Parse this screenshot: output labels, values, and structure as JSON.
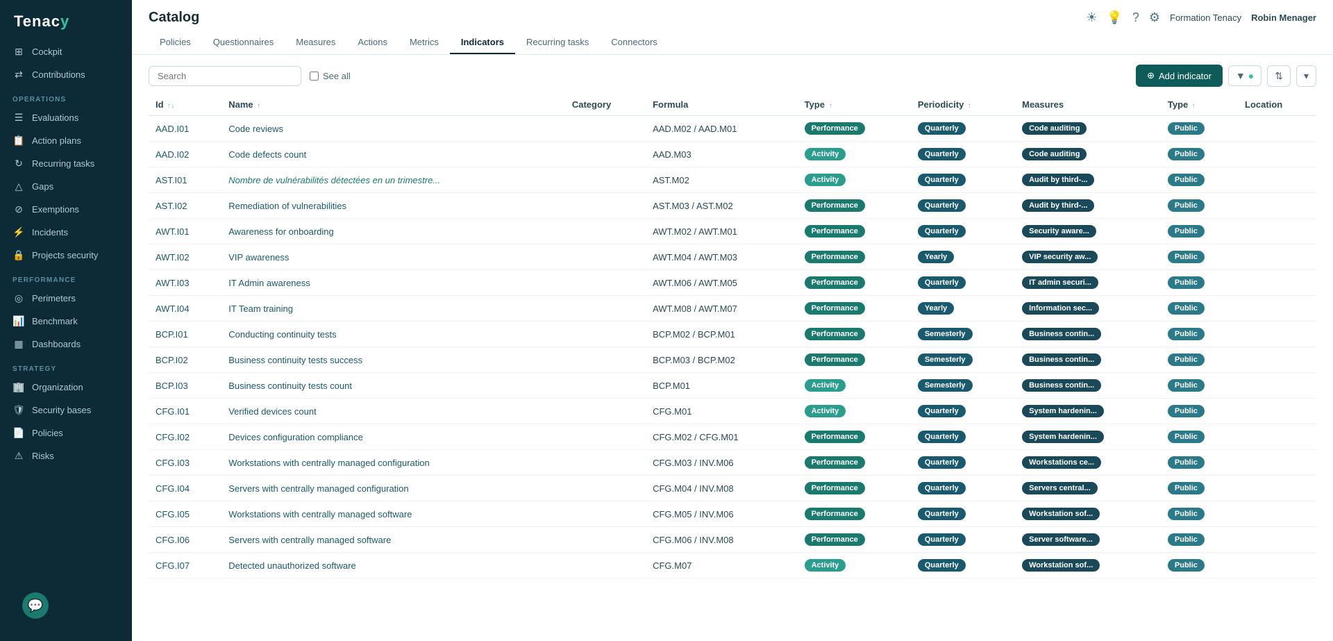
{
  "app": {
    "name": "Tenacy",
    "logo_accent": "y"
  },
  "topbar": {
    "title": "Catalog",
    "user_org": "Formation Tenacy",
    "user_name": "Robin Menager"
  },
  "tabs": [
    {
      "label": "Policies",
      "active": false
    },
    {
      "label": "Questionnaires",
      "active": false
    },
    {
      "label": "Measures",
      "active": false
    },
    {
      "label": "Actions",
      "active": false
    },
    {
      "label": "Metrics",
      "active": false
    },
    {
      "label": "Indicators",
      "active": true
    },
    {
      "label": "Recurring tasks",
      "active": false
    },
    {
      "label": "Connectors",
      "active": false
    }
  ],
  "toolbar": {
    "search_placeholder": "Search",
    "see_all_label": "See all",
    "add_button": "Add indicator"
  },
  "table": {
    "columns": [
      "Id",
      "Name",
      "Category",
      "Formula",
      "Type",
      "Periodicity",
      "Measures",
      "Type",
      "Location"
    ],
    "rows": [
      {
        "id": "AAD.I01",
        "name": "Code reviews",
        "category": "",
        "formula": "AAD.M02 / AAD.M01",
        "type": "Performance",
        "periodicity": "Quarterly",
        "measures": "Code auditing",
        "type2": "Public",
        "location": "",
        "name_italic": false
      },
      {
        "id": "AAD.I02",
        "name": "Code defects count",
        "category": "",
        "formula": "AAD.M03",
        "type": "Activity",
        "periodicity": "Quarterly",
        "measures": "Code auditing",
        "type2": "Public",
        "location": "",
        "name_italic": false
      },
      {
        "id": "AST.I01",
        "name": "Nombre de vulnérabilités détectées en un trimestre...",
        "category": "",
        "formula": "AST.M02",
        "type": "Activity",
        "periodicity": "Quarterly",
        "measures": "Audit by third-...",
        "type2": "Public",
        "location": "",
        "name_italic": true
      },
      {
        "id": "AST.I02",
        "name": "Remediation of vulnerabilities",
        "category": "",
        "formula": "AST.M03 / AST.M02",
        "type": "Performance",
        "periodicity": "Quarterly",
        "measures": "Audit by third-...",
        "type2": "Public",
        "location": "",
        "name_italic": false
      },
      {
        "id": "AWT.I01",
        "name": "Awareness for onboarding",
        "category": "",
        "formula": "AWT.M02 / AWT.M01",
        "type": "Performance",
        "periodicity": "Quarterly",
        "measures": "Security aware...",
        "type2": "Public",
        "location": "",
        "name_italic": false
      },
      {
        "id": "AWT.I02",
        "name": "VIP awareness",
        "category": "",
        "formula": "AWT.M04 / AWT.M03",
        "type": "Performance",
        "periodicity": "Yearly",
        "measures": "VIP security aw...",
        "type2": "Public",
        "location": "",
        "name_italic": false
      },
      {
        "id": "AWT.I03",
        "name": "IT Admin awareness",
        "category": "",
        "formula": "AWT.M06 / AWT.M05",
        "type": "Performance",
        "periodicity": "Quarterly",
        "measures": "IT admin securi...",
        "type2": "Public",
        "location": "",
        "name_italic": false
      },
      {
        "id": "AWT.I04",
        "name": "IT Team training",
        "category": "",
        "formula": "AWT.M08 / AWT.M07",
        "type": "Performance",
        "periodicity": "Yearly",
        "measures": "Information sec...",
        "type2": "Public",
        "location": "",
        "name_italic": false
      },
      {
        "id": "BCP.I01",
        "name": "Conducting continuity tests",
        "category": "",
        "formula": "BCP.M02 / BCP.M01",
        "type": "Performance",
        "periodicity": "Semesterly",
        "measures": "Business contin...",
        "type2": "Public",
        "location": "",
        "name_italic": false
      },
      {
        "id": "BCP.I02",
        "name": "Business continuity tests success",
        "category": "",
        "formula": "BCP.M03 / BCP.M02",
        "type": "Performance",
        "periodicity": "Semesterly",
        "measures": "Business contin...",
        "type2": "Public",
        "location": "",
        "name_italic": false
      },
      {
        "id": "BCP.I03",
        "name": "Business continuity tests count",
        "category": "",
        "formula": "BCP.M01",
        "type": "Activity",
        "periodicity": "Semesterly",
        "measures": "Business contin...",
        "type2": "Public",
        "location": "",
        "name_italic": false
      },
      {
        "id": "CFG.I01",
        "name": "Verified devices count",
        "category": "",
        "formula": "CFG.M01",
        "type": "Activity",
        "periodicity": "Quarterly",
        "measures": "System hardenin...",
        "type2": "Public",
        "location": "",
        "name_italic": false
      },
      {
        "id": "CFG.I02",
        "name": "Devices configuration compliance",
        "category": "",
        "formula": "CFG.M02 / CFG.M01",
        "type": "Performance",
        "periodicity": "Quarterly",
        "measures": "System hardenin...",
        "type2": "Public",
        "location": "",
        "name_italic": false
      },
      {
        "id": "CFG.I03",
        "name": "Workstations with centrally managed configuration",
        "category": "",
        "formula": "CFG.M03 / INV.M06",
        "type": "Performance",
        "periodicity": "Quarterly",
        "measures": "Workstations ce...",
        "type2": "Public",
        "location": "",
        "name_italic": false
      },
      {
        "id": "CFG.I04",
        "name": "Servers with centrally managed configuration",
        "category": "",
        "formula": "CFG.M04 / INV.M08",
        "type": "Performance",
        "periodicity": "Quarterly",
        "measures": "Servers central...",
        "type2": "Public",
        "location": "",
        "name_italic": false
      },
      {
        "id": "CFG.I05",
        "name": "Workstations with centrally managed software",
        "category": "",
        "formula": "CFG.M05 / INV.M06",
        "type": "Performance",
        "periodicity": "Quarterly",
        "measures": "Workstation sof...",
        "type2": "Public",
        "location": "",
        "name_italic": false
      },
      {
        "id": "CFG.I06",
        "name": "Servers with centrally managed software",
        "category": "",
        "formula": "CFG.M06 / INV.M08",
        "type": "Performance",
        "periodicity": "Quarterly",
        "measures": "Server software...",
        "type2": "Public",
        "location": "",
        "name_italic": false
      },
      {
        "id": "CFG.I07",
        "name": "Detected unauthorized software",
        "category": "",
        "formula": "CFG.M07",
        "type": "Activity",
        "periodicity": "Quarterly",
        "measures": "Workstation sof...",
        "type2": "Public",
        "location": "",
        "name_italic": false
      }
    ]
  },
  "sidebar": {
    "logo": "Tenac",
    "logo_y": "y",
    "sections": [
      {
        "label": "OPERATIONS",
        "items": [
          {
            "icon": "⊞",
            "label": "Cockpit"
          },
          {
            "icon": "⇄",
            "label": "Contributions"
          }
        ]
      },
      {
        "label": "",
        "items": [
          {
            "icon": "☰",
            "label": "Evaluations"
          },
          {
            "icon": "📋",
            "label": "Action plans"
          },
          {
            "icon": "↻",
            "label": "Recurring tasks"
          },
          {
            "icon": "△",
            "label": "Gaps"
          },
          {
            "icon": "⊘",
            "label": "Exemptions"
          },
          {
            "icon": "⚡",
            "label": "Incidents"
          },
          {
            "icon": "🔒",
            "label": "Projects security"
          }
        ]
      },
      {
        "label": "PERFORMANCE",
        "items": [
          {
            "icon": "◎",
            "label": "Perimeters"
          },
          {
            "icon": "📊",
            "label": "Benchmark"
          },
          {
            "icon": "▦",
            "label": "Dashboards"
          }
        ]
      },
      {
        "label": "STRATEGY",
        "items": [
          {
            "icon": "🏢",
            "label": "Organization"
          },
          {
            "icon": "🛡",
            "label": "Security bases"
          },
          {
            "icon": "📄",
            "label": "Policies"
          },
          {
            "icon": "⚠",
            "label": "Risks"
          }
        ]
      }
    ]
  }
}
